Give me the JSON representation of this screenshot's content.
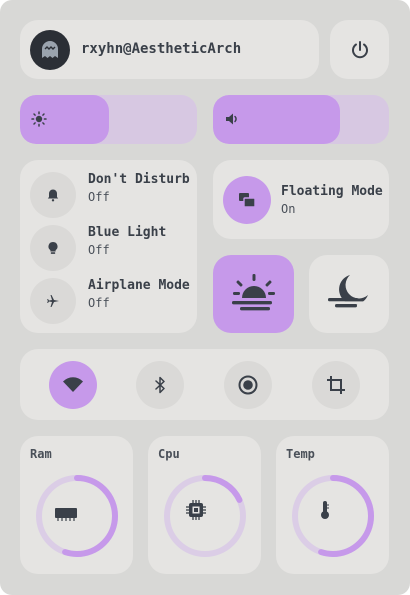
{
  "header": {
    "username": "rxyhn@AestheticArch",
    "avatar_icon": "ghost-icon",
    "power_icon": "power-icon"
  },
  "sliders": {
    "brightness": {
      "icon": "sun-icon",
      "level": 0.5
    },
    "volume": {
      "icon": "speaker-icon",
      "level": 0.72
    }
  },
  "toggles": [
    {
      "label": "Don't Disturb",
      "state": "Off",
      "icon": "bell-icon"
    },
    {
      "label": "Blue Light",
      "state": "Off",
      "icon": "bulb-icon"
    },
    {
      "label": "Airplane Mode",
      "state": "Off",
      "icon": "airplane-icon"
    }
  ],
  "floating": {
    "label": "Floating Mode",
    "state": "On",
    "icon": "floating-windows-icon"
  },
  "theme": {
    "light_icon": "sunset-icon",
    "dark_icon": "moon-icon"
  },
  "quick": [
    {
      "name": "wifi",
      "icon": "wifi-icon",
      "active": true
    },
    {
      "name": "bluetooth",
      "icon": "bluetooth-icon",
      "active": false
    },
    {
      "name": "screen-record",
      "icon": "record-icon",
      "active": false
    },
    {
      "name": "screenshot",
      "icon": "crop-icon",
      "active": false
    }
  ],
  "stats": {
    "ram": {
      "label": "Ram",
      "usage": 0.55,
      "icon": "memory-icon"
    },
    "cpu": {
      "label": "Cpu",
      "usage": 0.18,
      "icon": "chip-icon"
    },
    "temp": {
      "label": "Temp",
      "usage": 0.55,
      "icon": "thermometer-icon"
    }
  },
  "colors": {
    "accent": "#c699ea",
    "track": "#dbcde6",
    "panel": "#d8d8d6",
    "card": "#e5e4e2",
    "text": "#3a4049"
  }
}
